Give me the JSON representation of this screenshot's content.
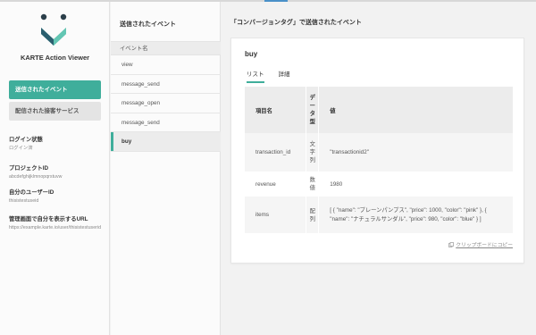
{
  "app": {
    "title": "KARTE Action Viewer",
    "logo": "karte-smile-logo"
  },
  "sidebar": {
    "nav": [
      {
        "label": "送信されたイベント",
        "active": true
      },
      {
        "label": "配信された接客サービス",
        "active": false
      }
    ],
    "info": [
      {
        "label": "ログイン状態",
        "value": "ログイン済"
      },
      {
        "label": "プロジェクトID",
        "value": "abcdefghijklmnopqrstuvw"
      },
      {
        "label": "自分のユーザーID",
        "value": "thisistestuseid"
      },
      {
        "label": "管理画面で自分を表示するURL",
        "value": "https://example.karte.io/user/thisistestuserid"
      }
    ]
  },
  "events": {
    "title": "送信されたイベント",
    "header": "イベント名",
    "items": [
      {
        "label": "view",
        "selected": false
      },
      {
        "label": "message_send",
        "selected": false
      },
      {
        "label": "message_open",
        "selected": false
      },
      {
        "label": "message_send",
        "selected": false
      },
      {
        "label": "buy",
        "selected": true
      }
    ]
  },
  "main": {
    "title": "「コンバージョンタグ」で送信されたイベント",
    "event_name": "buy",
    "tabs": [
      {
        "label": "リスト",
        "active": true
      },
      {
        "label": "詳細",
        "active": false
      }
    ],
    "table": {
      "headers": [
        "項目名",
        "データ型",
        "値"
      ],
      "rows": [
        {
          "name": "transaction_id",
          "type": "文字列",
          "value": "\"transactionid2\""
        },
        {
          "name": "revenue",
          "type": "数値",
          "value": "1980"
        },
        {
          "name": "items",
          "type": "配列",
          "value": "[ { \"name\": \"プレーンパンプス\", \"price\": 1000, \"color\": \"pink\" }, { \"name\": \"ナチュラルサンダル\", \"price\": 980, \"color\": \"blue\" } ]"
        }
      ]
    },
    "copy_label": "クリップボードにコピー",
    "copy_icon": "copy-icon"
  },
  "colors": {
    "accent": "#3fae9b",
    "logo_dark": "#2b5f6f"
  }
}
